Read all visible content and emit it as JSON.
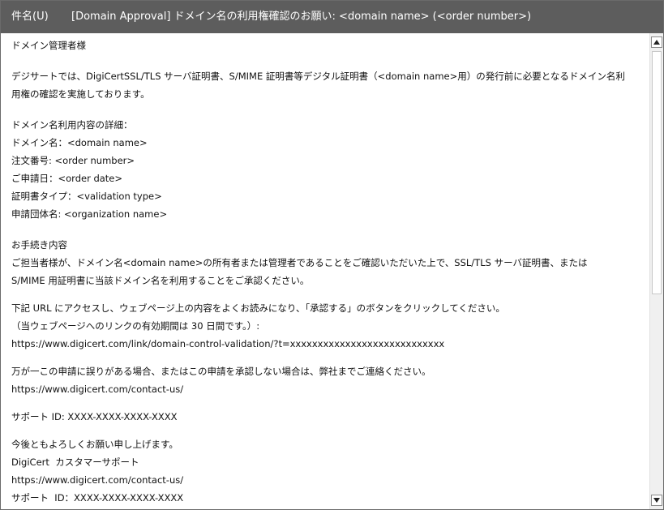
{
  "header": {
    "subject_label": "件名(U)",
    "subject_text": "[Domain Approval] ドメイン名の利用権確認のお願い: <domain name> (<order number>)"
  },
  "email": {
    "greeting": "ドメイン管理者様",
    "intro_line1": "デジサートでは、DigiCertSSL/TLS サーバ証明書、S/MIME 証明書等デジタル証明書（<domain name>用）の発行前に必要となるドメイン名利",
    "intro_line2": "用権の確認を実施しております。",
    "details_heading": "ドメイン名利用内容の詳細：",
    "details": [
      "ドメイン名：<domain name>",
      "注文番号: <order number>",
      "ご申請日：<order date>",
      "証明書タイプ：<validation type>",
      "申請団体名: <organization name>"
    ],
    "procedure_heading": "お手続き内容",
    "procedure_line1": "ご担当者様が、ドメイン名<domain name>の所有者または管理者であることをご確認いただいた上で、SSL/TLS サーバ証明書、または",
    "procedure_line2": "S/MIME 用証明書に当該ドメイン名を利用することをご承認ください。",
    "access_line1": "下記 URL にアクセスし、ウェブページ上の内容をよくお読みになり、「承認する」のボタンをクリックしてください。",
    "access_line2": "（当ウェブページへのリンクの有効期間は 30 日間です。）:",
    "validation_url": "https://www.digicert.com/link/domain-control-validation/?t=xxxxxxxxxxxxxxxxxxxxxxxxxxxx",
    "error_line": "万が一この申請に誤りがある場合、またはこの申請を承認しない場合は、弊社までご連絡ください。",
    "contact_url": "https://www.digicert.com/contact-us/",
    "support_id_line": "サポート ID: XXXX-XXXX-XXXX-XXXX",
    "closing": "今後ともよろしくお願い申し上げます。",
    "signature_name": "DigiCert  カスタマーサポート",
    "signature_url": "https://www.digicert.com/contact-us/",
    "signature_support": "サポート  ID：XXXX-XXXX-XXXX-XXXX"
  },
  "scrollbar": {
    "up_icon": "scroll-up-arrow-icon",
    "down_icon": "scroll-down-arrow-icon"
  }
}
